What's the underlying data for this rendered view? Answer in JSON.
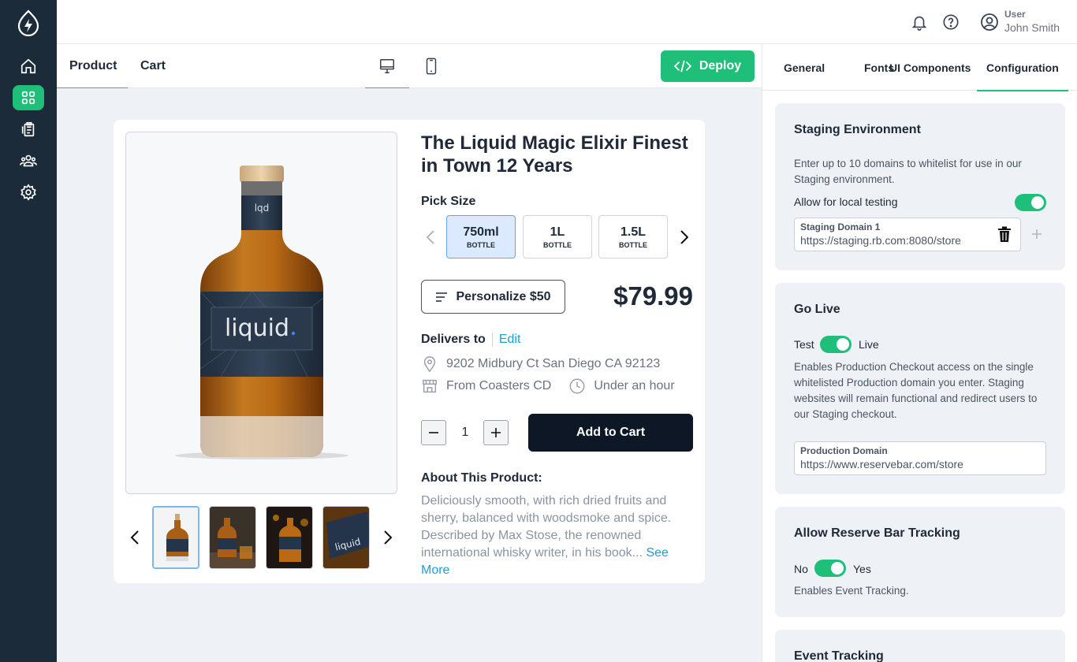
{
  "user": {
    "role": "User",
    "name": "John Smith"
  },
  "tabs": {
    "product": "Product",
    "cart": "Cart"
  },
  "deploy_label": "Deploy",
  "product": {
    "title": "The Liquid Magic Elixir Finest in Town 12 Years",
    "pick_size_label": "Pick Size",
    "sizes": [
      {
        "main": "750ml",
        "sub": "BOTTLE",
        "selected": true
      },
      {
        "main": "1L",
        "sub": "BOTTLE",
        "selected": false
      },
      {
        "main": "1.5L",
        "sub": "BOTTLE",
        "selected": false
      }
    ],
    "personalize_label": "Personalize $50",
    "price": "$79.99",
    "delivers_to_label": "Delivers to",
    "edit_label": "Edit",
    "address": "9202 Midbury Ct San Diego CA 92123",
    "store": "From Coasters CD",
    "eta": "Under an hour",
    "quantity": "1",
    "add_to_cart_label": "Add to Cart",
    "about_label": "About This Product:",
    "about_text": "Deliciously smooth, with rich dried fruits and sherry, balanced with woodsmoke and spice. Described by Max Stose, the renowned international whisky writer, in his book...",
    "see_more_label": "See More",
    "bottle_brand": "liquid",
    "bottle_cap_brand": "lqd"
  },
  "config": {
    "tabs": [
      "General",
      "Fonts",
      "UI Components",
      "Configuration"
    ],
    "staging": {
      "title": "Staging Environment",
      "description": "Enter up to 10 domains to whitelist for use in our Staging environment.",
      "local_testing_label": "Allow for local testing",
      "local_testing": true,
      "domain_label": "Staging Domain 1",
      "domain_value": "https://staging.rb.com:8080/store"
    },
    "go_live": {
      "title": "Go Live",
      "off_label": "Test",
      "on_label": "Live",
      "enabled": true,
      "description": "Enables Production Checkout access on the single whitelisted Production domain you enter. Staging websites will remain functional and redirect users to our Staging checkout.",
      "domain_label": "Production Domain",
      "domain_value": "https://www.reservebar.com/store"
    },
    "tracking": {
      "title": "Allow Reserve Bar Tracking",
      "off_label": "No",
      "on_label": "Yes",
      "enabled": true,
      "description": "Enables Event Tracking."
    },
    "event_tracking_title": "Event Tracking"
  },
  "colors": {
    "accent": "#1fbf7a",
    "sidebar": "#1c2b3a",
    "link": "#1aa0d8",
    "dark_button": "#0d1726"
  }
}
